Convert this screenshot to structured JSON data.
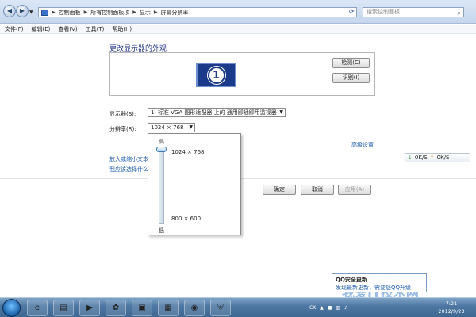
{
  "address": {
    "path": [
      "控制面板",
      "所有控制面板项",
      "显示",
      "屏幕分辨率"
    ],
    "search_placeholder": "搜索控制面板"
  },
  "menu": [
    "文件(F)",
    "编辑(E)",
    "查看(V)",
    "工具(T)",
    "帮助(H)"
  ],
  "page": {
    "title": "更改显示器的外观",
    "monitor_number": "1",
    "detect_button": "检测(C)",
    "identify_button": "识别(I)",
    "display_label": "显示器(S):",
    "display_value": "1. 标准 VGA 图形适配器 上的 通用即插即用监视器",
    "resolution_label": "分辨率(R):",
    "resolution_value": "1024 × 768",
    "advanced_link": "高级设置",
    "link1": "放大或缩小文本",
    "link2": "我应该选择什么",
    "ok_button": "确定",
    "cancel_button": "取消",
    "apply_button": "应用(A)"
  },
  "resolution_dropdown": {
    "high_label": "高",
    "low_label": "低",
    "top_option": "1024 × 768",
    "bottom_option": "800 × 600",
    "slider_level": 1.0
  },
  "speed_widget": {
    "down": "0K/S",
    "up": "0K/S"
  },
  "qq_popup": {
    "title": "QQ安全更新",
    "message": "发现最新更新，需要您QQ升级"
  },
  "watermark": {
    "text": "我爱IT技术网"
  },
  "taskbar": {
    "tray_text": "CK",
    "time": "7:21",
    "date": "2012/9/23"
  },
  "colors": {
    "title_blue": "#1e3287",
    "link_blue": "#1a5aad",
    "monitor_blue": "#1b3a8a",
    "taskbar_blue": "#4f79a4"
  }
}
